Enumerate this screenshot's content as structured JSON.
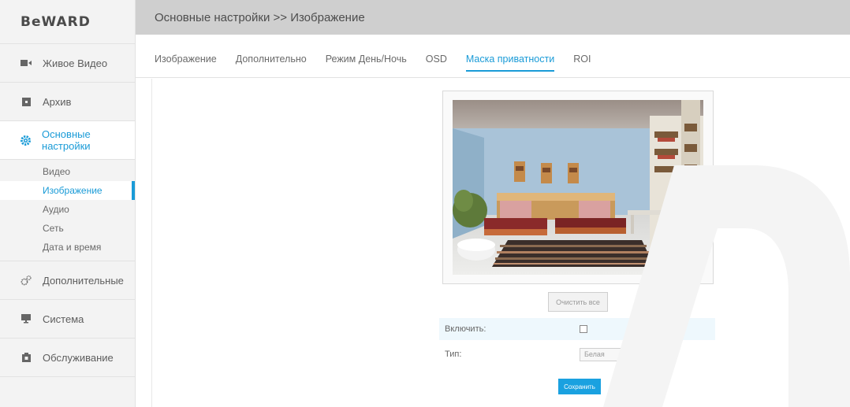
{
  "logo": "BeWARD",
  "sidebar": {
    "items": [
      {
        "label": "Живое Видео",
        "icon": "video-icon"
      },
      {
        "label": "Архив",
        "icon": "archive-icon"
      },
      {
        "label": "Основные настройки",
        "icon": "gear-icon"
      },
      {
        "label": "Дополнительные",
        "icon": "gears-icon"
      },
      {
        "label": "Система",
        "icon": "monitor-icon"
      },
      {
        "label": "Обслуживание",
        "icon": "maintenance-icon"
      }
    ],
    "subitems": [
      "Видео",
      "Изображение",
      "Аудио",
      "Сеть",
      "Дата и время"
    ]
  },
  "header": {
    "breadcrumb": "Основные настройки >> Изображение"
  },
  "tabs": [
    "Изображение",
    "Дополнительно",
    "Режим День/Ночь",
    "OSD",
    "Маска приватности",
    "ROI"
  ],
  "form": {
    "clear_all": "Очистить все",
    "enable_label": "Включить:",
    "type_label": "Тип:",
    "type_value": "Белая",
    "save": "Сохранить"
  },
  "colors": {
    "accent": "#1a9bd7",
    "header_bg": "#cfcfcf",
    "sidebar_bg": "#f3f3f3"
  }
}
